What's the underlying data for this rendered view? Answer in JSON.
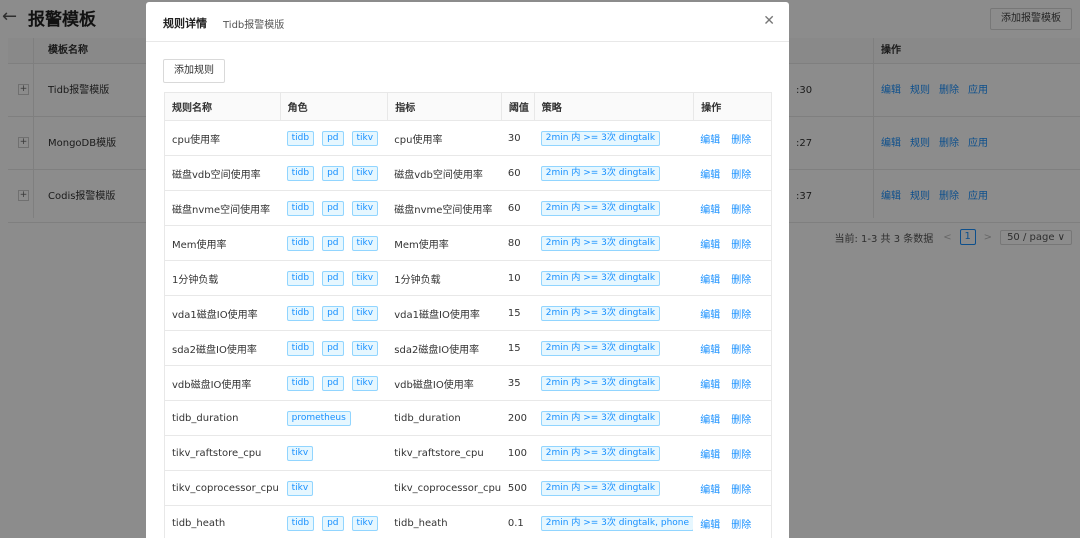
{
  "background": {
    "back_icon": "←",
    "title": "报警模板",
    "add_template_button": "添加报警模板",
    "table": {
      "header_name": "模板名称",
      "header_ops": "操作",
      "rows": [
        {
          "expand": "+",
          "name": "Tidb报警模版",
          "time_tail": ":30",
          "ops": [
            "编辑",
            "规则",
            "删除",
            "应用"
          ]
        },
        {
          "expand": "+",
          "name": "MongoDB模版",
          "time_tail": ":27",
          "ops": [
            "编辑",
            "规则",
            "删除",
            "应用"
          ]
        },
        {
          "expand": "+",
          "name": "Codis报警模版",
          "time_tail": ":37",
          "ops": [
            "编辑",
            "规则",
            "删除",
            "应用"
          ]
        }
      ]
    },
    "pagination": {
      "summary": "当前: 1-3 共 3 条数据",
      "prev": "<",
      "current_page": "1",
      "next": ">",
      "page_size": "50 / page ∨"
    }
  },
  "modal": {
    "title": "规则详情",
    "subtitle": "Tidb报警模版",
    "close_icon": "✕",
    "add_rule_button": "添加规则",
    "columns": {
      "name": "规则名称",
      "role": "角色",
      "metric": "指标",
      "threshold": "阈值",
      "policy": "策略",
      "ops": "操作"
    },
    "rows": [
      {
        "name": "cpu使用率",
        "roles": [
          "tidb",
          "pd",
          "tikv"
        ],
        "metric": "cpu使用率",
        "threshold": "30",
        "policy": "2min 内 >= 3次 dingtalk",
        "ops": [
          "编辑",
          "删除"
        ]
      },
      {
        "name": "磁盘vdb空间使用率",
        "roles": [
          "tidb",
          "pd",
          "tikv"
        ],
        "metric": "磁盘vdb空间使用率",
        "threshold": "60",
        "policy": "2min 内 >= 3次 dingtalk",
        "ops": [
          "编辑",
          "删除"
        ]
      },
      {
        "name": "磁盘nvme空间使用率",
        "roles": [
          "tidb",
          "pd",
          "tikv"
        ],
        "metric": "磁盘nvme空间使用率",
        "threshold": "60",
        "policy": "2min 内 >= 3次 dingtalk",
        "ops": [
          "编辑",
          "删除"
        ]
      },
      {
        "name": "Mem使用率",
        "roles": [
          "tidb",
          "pd",
          "tikv"
        ],
        "metric": "Mem使用率",
        "threshold": "80",
        "policy": "2min 内 >= 3次 dingtalk",
        "ops": [
          "编辑",
          "删除"
        ]
      },
      {
        "name": "1分钟负载",
        "roles": [
          "tidb",
          "pd",
          "tikv"
        ],
        "metric": "1分钟负载",
        "threshold": "10",
        "policy": "2min 内 >= 3次 dingtalk",
        "ops": [
          "编辑",
          "删除"
        ]
      },
      {
        "name": "vda1磁盘IO使用率",
        "roles": [
          "tidb",
          "pd",
          "tikv"
        ],
        "metric": "vda1磁盘IO使用率",
        "threshold": "15",
        "policy": "2min 内 >= 3次 dingtalk",
        "ops": [
          "编辑",
          "删除"
        ]
      },
      {
        "name": "sda2磁盘IO使用率",
        "roles": [
          "tidb",
          "pd",
          "tikv"
        ],
        "metric": "sda2磁盘IO使用率",
        "threshold": "15",
        "policy": "2min 内 >= 3次 dingtalk",
        "ops": [
          "编辑",
          "删除"
        ]
      },
      {
        "name": "vdb磁盘IO使用率",
        "roles": [
          "tidb",
          "pd",
          "tikv"
        ],
        "metric": "vdb磁盘IO使用率",
        "threshold": "35",
        "policy": "2min 内 >= 3次 dingtalk",
        "ops": [
          "编辑",
          "删除"
        ]
      },
      {
        "name": "tidb_duration",
        "roles": [
          "prometheus"
        ],
        "metric": "tidb_duration",
        "threshold": "200",
        "policy": "2min 内 >= 3次 dingtalk",
        "ops": [
          "编辑",
          "删除"
        ]
      },
      {
        "name": "tikv_raftstore_cpu",
        "roles": [
          "tikv"
        ],
        "metric": "tikv_raftstore_cpu",
        "threshold": "100",
        "policy": "2min 内 >= 3次 dingtalk",
        "ops": [
          "编辑",
          "删除"
        ]
      },
      {
        "name": "tikv_coprocessor_cpu",
        "roles": [
          "tikv"
        ],
        "metric": "tikv_coprocessor_cpu",
        "threshold": "500",
        "policy": "2min 内 >= 3次 dingtalk",
        "ops": [
          "编辑",
          "删除"
        ]
      },
      {
        "name": "tidb_heath",
        "roles": [
          "tidb",
          "pd",
          "tikv"
        ],
        "metric": "tidb_heath",
        "threshold": "0.1",
        "policy": "2min 内 >= 3次 dingtalk, phone",
        "ops": [
          "编辑",
          "删除"
        ]
      }
    ]
  },
  "colors": {
    "link": "#1890ff",
    "tag_bg": "#e6f7ff",
    "tag_border": "#91d5ff",
    "mask": "rgba(0,0,0,0.45)"
  }
}
